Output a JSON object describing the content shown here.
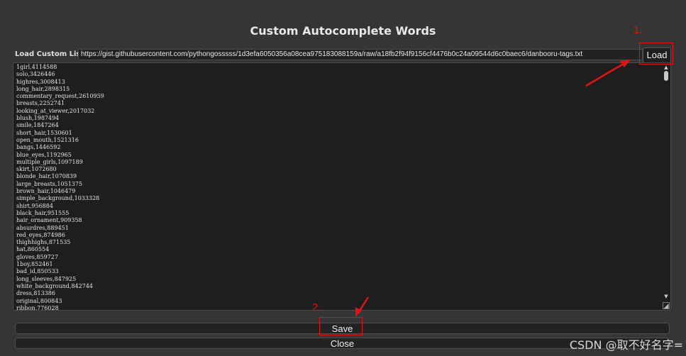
{
  "dialog": {
    "title": "Custom Autocomplete Words",
    "url_label": "Load Custom List:",
    "url_value": "https://gist.githubusercontent.com/pythongosssss/1d3efa6050356a08cea975183088159a/raw/a18fb2f94f9156cf4476b0c24a09544d6c0baec6/danbooru-tags.txt",
    "load_label": "Load",
    "save_label": "Save",
    "close_label": "Close"
  },
  "words": [
    "1girl,4114588",
    "solo,3426446",
    "highres,3008413",
    "long_hair,2898315",
    "commentary_request,2610959",
    "breasts,2252741",
    "looking_at_viewer,2017032",
    "blush,1987494",
    "smile,1847264",
    "short_hair,1530601",
    "open_mouth,1521316",
    "bangs,1446592",
    "blue_eyes,1192965",
    "multiple_girls,1097189",
    "skirt,1072680",
    "blonde_hair,1070839",
    "large_breasts,1051375",
    "brown_hair,1046479",
    "simple_background,1033328",
    "shirt,956884",
    "black_hair,951555",
    "hair_ornament,909358",
    "absurdres,889451",
    "red_eyes,874986",
    "thighhighs,871535",
    "hat,860554",
    "gloves,859727",
    "1boy,852461",
    "bad_id,850533",
    "long_sleeves,847925",
    "white_background,842744",
    "dress,813386",
    "original,800843",
    "ribbon,776028"
  ],
  "annotations": {
    "step1": "1.",
    "step2": "2.",
    "accent_color": "#e01414"
  },
  "watermark": "CSDN @取不好名字="
}
